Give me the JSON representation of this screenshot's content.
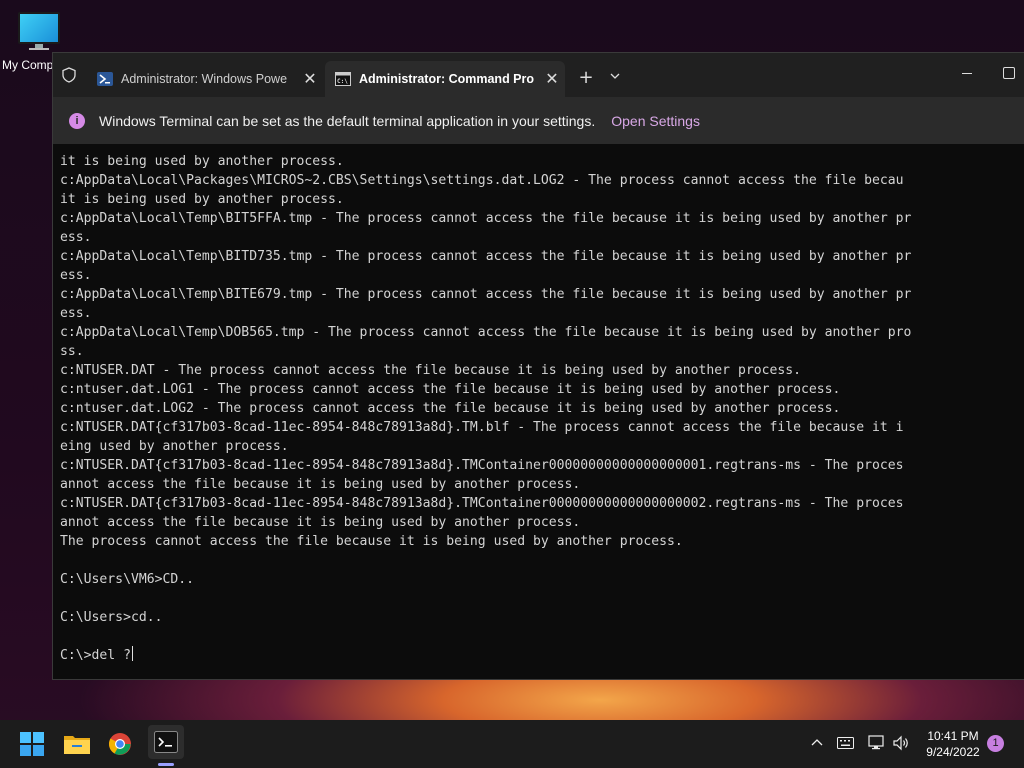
{
  "desktop": {
    "icon_label": "My Comp"
  },
  "window": {
    "tabs": [
      {
        "label": "Administrator: Windows Powe",
        "icon": "powershell-icon",
        "active": false
      },
      {
        "label": "Administrator: Command Pro",
        "icon": "cmd-icon",
        "active": true
      }
    ],
    "close_glyph": "✕",
    "new_tab_glyph": "+"
  },
  "infobar": {
    "message": "Windows Terminal can be set as the default terminal application in your settings.",
    "link": "Open Settings",
    "icon_glyph": "i"
  },
  "console": {
    "lines": [
      "it is being used by another process.",
      "c:AppData\\Local\\Packages\\MICROS~2.CBS\\Settings\\settings.dat.LOG2 - The process cannot access the file becau",
      "it is being used by another process.",
      "c:AppData\\Local\\Temp\\BIT5FFA.tmp - The process cannot access the file because it is being used by another pr",
      "ess.",
      "c:AppData\\Local\\Temp\\BITD735.tmp - The process cannot access the file because it is being used by another pr",
      "ess.",
      "c:AppData\\Local\\Temp\\BITE679.tmp - The process cannot access the file because it is being used by another pr",
      "ess.",
      "c:AppData\\Local\\Temp\\DOB565.tmp - The process cannot access the file because it is being used by another pro",
      "ss.",
      "c:NTUSER.DAT - The process cannot access the file because it is being used by another process.",
      "c:ntuser.dat.LOG1 - The process cannot access the file because it is being used by another process.",
      "c:ntuser.dat.LOG2 - The process cannot access the file because it is being used by another process.",
      "c:NTUSER.DAT{cf317b03-8cad-11ec-8954-848c78913a8d}.TM.blf - The process cannot access the file because it i",
      "eing used by another process.",
      "c:NTUSER.DAT{cf317b03-8cad-11ec-8954-848c78913a8d}.TMContainer00000000000000000001.regtrans-ms - The proces",
      "annot access the file because it is being used by another process.",
      "c:NTUSER.DAT{cf317b03-8cad-11ec-8954-848c78913a8d}.TMContainer00000000000000000002.regtrans-ms - The proces",
      "annot access the file because it is being used by another process.",
      "The process cannot access the file because it is being used by another process.",
      "",
      "C:\\Users\\VM6>CD..",
      "",
      "C:\\Users>cd..",
      "",
      "C:\\>del ?"
    ]
  },
  "taskbar": {
    "apps": [
      "start-icon",
      "file-explorer-icon",
      "chrome-icon",
      "terminal-icon"
    ],
    "clock_time": "10:41 PM",
    "clock_date": "9/24/2022",
    "notification_count": "1"
  },
  "colors": {
    "terminal_bg": "#0c0c0c",
    "titlebar_bg": "#202020",
    "infobar_bg": "#2b2b2b",
    "link": "#d8a8e6",
    "taskbar_bg": "#1c1c1c"
  }
}
